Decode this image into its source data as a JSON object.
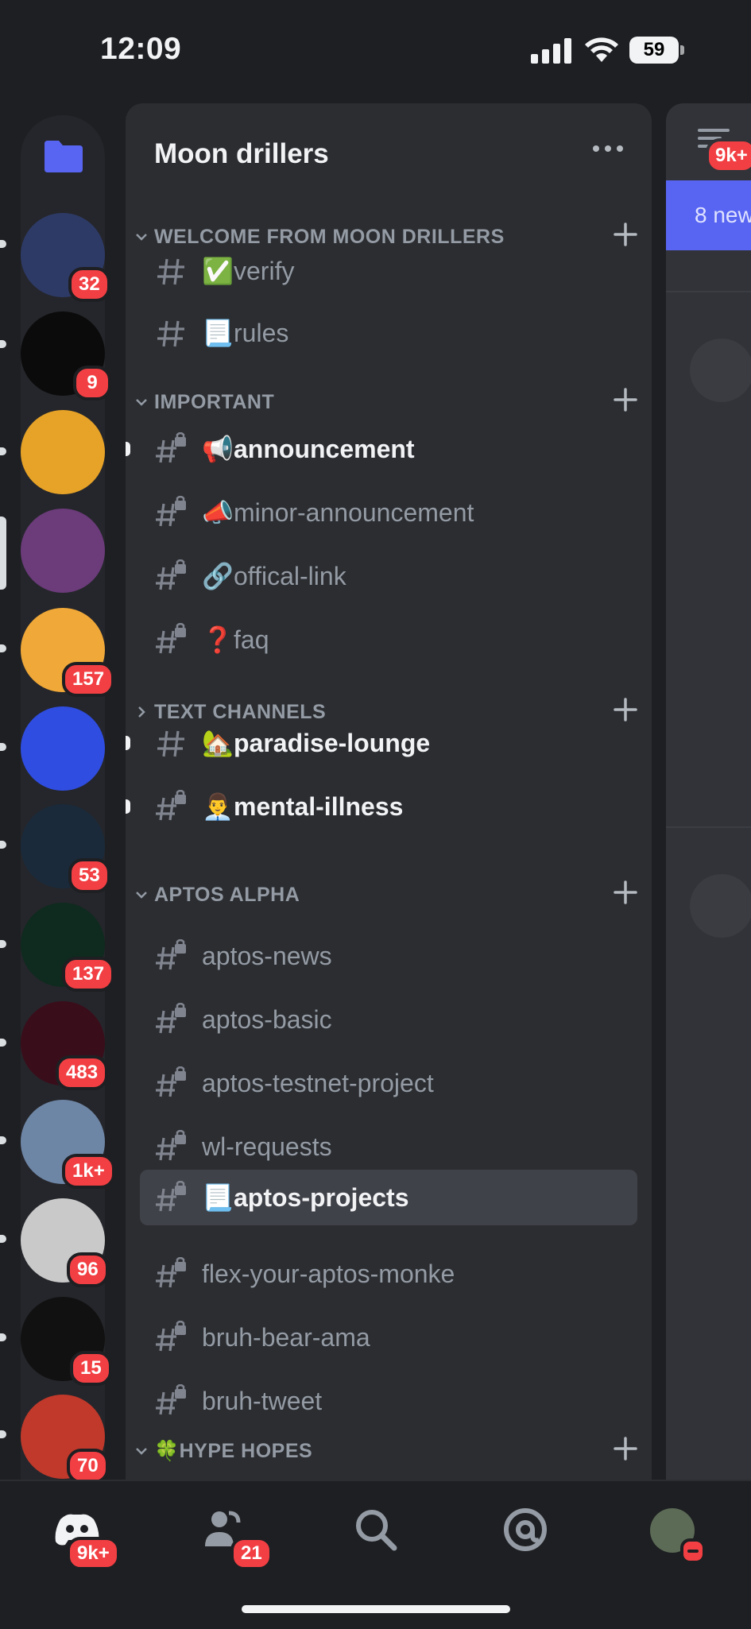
{
  "status_bar": {
    "time": "12:09",
    "battery": "59"
  },
  "server": {
    "name": "Moon drillers"
  },
  "guilds": [
    {
      "badge": "32",
      "color": "#2d3a66"
    },
    {
      "badge": "9",
      "color": "#0b0b0b"
    },
    {
      "badge": "",
      "color": "#e7a327"
    },
    {
      "badge": "",
      "color": "#6b3b7a"
    },
    {
      "badge": "157",
      "color": "#f0a838"
    },
    {
      "badge": "",
      "color": "#2f4de0"
    },
    {
      "badge": "53",
      "color": "#1a2a3a"
    },
    {
      "badge": "137",
      "color": "#0f2a1e"
    },
    {
      "badge": "483",
      "color": "#3a0d1a"
    },
    {
      "badge": "1k+",
      "color": "#6e86a6"
    },
    {
      "badge": "96",
      "color": "#c9c9c9"
    },
    {
      "badge": "15",
      "color": "#111111"
    },
    {
      "badge": "70",
      "color": "#c0392b"
    }
  ],
  "categories": [
    {
      "label": "WELCOME FROM MOON DRILLERS"
    },
    {
      "label": "IMPORTANT"
    },
    {
      "label": "TEXT CHANNELS"
    },
    {
      "label": "APTOS ALPHA"
    },
    {
      "label": "🍀HYPE HOPES"
    }
  ],
  "channels": [
    {
      "emoji": "✅",
      "name": "verify"
    },
    {
      "emoji": "📃",
      "name": "rules"
    },
    {
      "emoji": "📢",
      "name": "announcement"
    },
    {
      "emoji": "📣",
      "name": "minor-announcement"
    },
    {
      "emoji": "🔗",
      "name": "offical-link"
    },
    {
      "emoji": "❓",
      "name": "faq"
    },
    {
      "emoji": "🏡",
      "name": "paradise-lounge"
    },
    {
      "emoji": "👨‍💼",
      "name": "mental-illness"
    },
    {
      "emoji": "",
      "name": "aptos-news"
    },
    {
      "emoji": "",
      "name": "aptos-basic"
    },
    {
      "emoji": "",
      "name": "aptos-testnet-project"
    },
    {
      "emoji": "",
      "name": "wl-requests"
    },
    {
      "emoji": "📃",
      "name": "aptos-projects"
    },
    {
      "emoji": "",
      "name": "flex-your-aptos-monke"
    },
    {
      "emoji": "",
      "name": "bruh-bear-ama"
    },
    {
      "emoji": "",
      "name": "bruh-tweet"
    }
  ],
  "peek": {
    "badge": "9k+",
    "banner": "8 new"
  },
  "tabbar": {
    "home_badge": "9k+",
    "friends_badge": "21"
  },
  "colors": {
    "accent": "#5865f2",
    "badge": "#f23f43",
    "panel": "#2b2d31",
    "rail": "#1e1f22"
  }
}
